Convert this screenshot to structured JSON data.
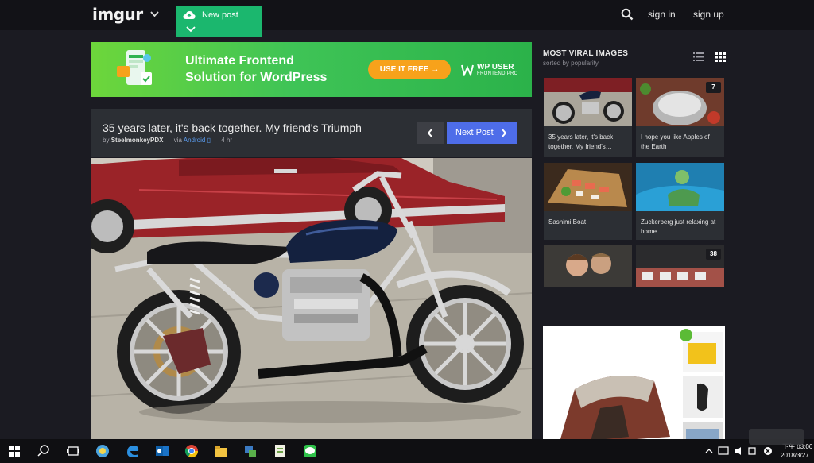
{
  "header": {
    "logo_text": "imgur",
    "new_post_label": "New post",
    "sign_in_label": "sign in",
    "sign_up_label": "sign up"
  },
  "ad_banner": {
    "headline_line1": "Ultimate Frontend",
    "headline_line2": "Solution for WordPress",
    "cta_label": "USE IT FREE →",
    "brand_name": "WP USER",
    "brand_sub": "FRONTEND PRO"
  },
  "post": {
    "title": "35 years later, it's back together. My friend's Triumph",
    "by_prefix": "by",
    "author": "SteelmonkeyPDX",
    "via_prefix": "via",
    "via_platform": "Android",
    "age": "4 hr",
    "next_label": "Next Post"
  },
  "sidebar": {
    "title": "MOST VIRAL IMAGES",
    "subtitle": "sorted by popularity",
    "tiles": [
      {
        "caption": "35 years later, it's back together. My friend's…",
        "badge": ""
      },
      {
        "caption": "I hope you like Apples of the Earth",
        "badge": "7"
      },
      {
        "caption": "Sashimi Boat",
        "badge": ""
      },
      {
        "caption": "Zuckerberg just relaxing at home",
        "badge": ""
      },
      {
        "caption": "",
        "badge": ""
      },
      {
        "caption": "",
        "badge": "38"
      }
    ]
  },
  "taskbar": {
    "time_label": "下午 03:06",
    "date_label": "2018/3/27"
  },
  "colors": {
    "background": "#1b1b22",
    "new_post_green": "#1bb76e",
    "next_post_blue": "#4e6de9",
    "ad_cta_orange": "#f7a21b"
  },
  "icons": [
    "chevron-down-icon",
    "cloud-upload-icon",
    "search-icon",
    "chevron-left-icon",
    "chevron-right-icon",
    "list-view-icon",
    "grid-view-icon",
    "windows-start-icon"
  ]
}
